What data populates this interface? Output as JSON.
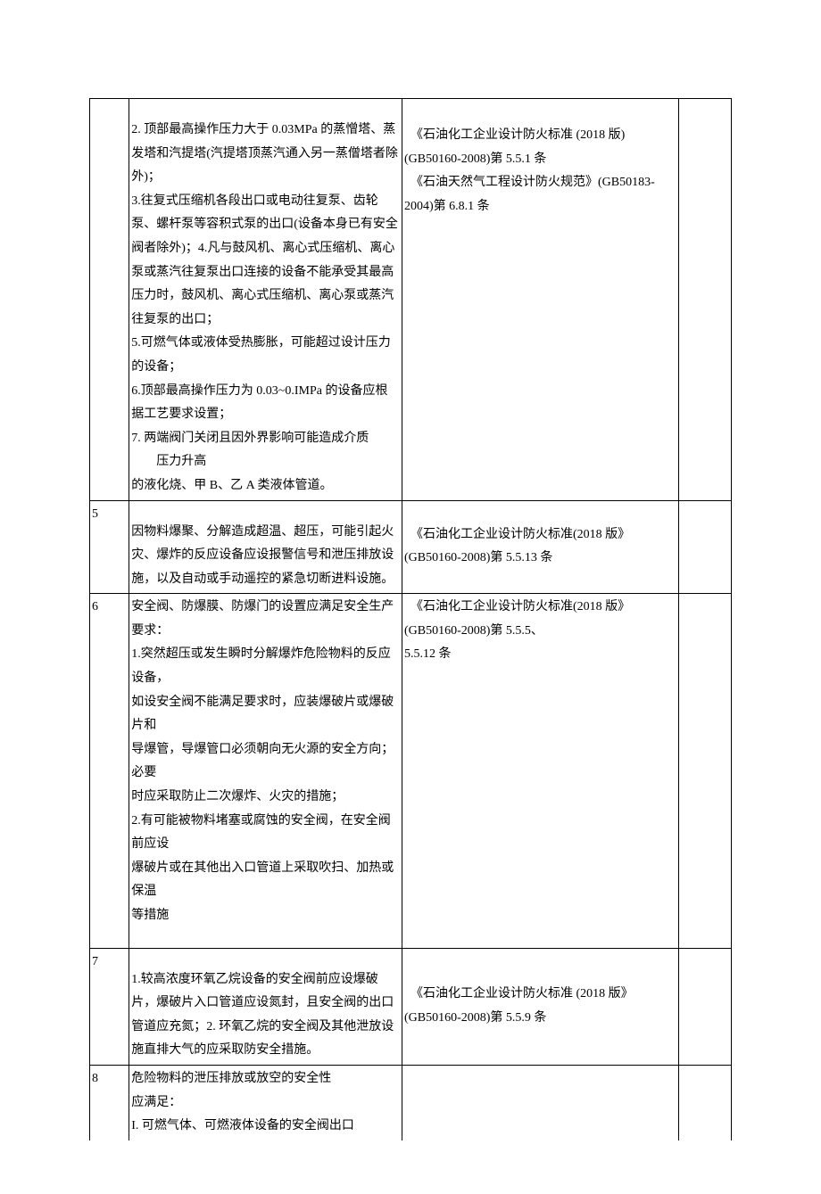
{
  "rows": [
    {
      "num": "",
      "req": "\n2. 顶部最高操作压力大于 0.03MPa 的蒸憎塔、蒸发塔和汽提塔(汽提塔顶蒸汽通入另一蒸僧塔者除外)；\n3.往复式压缩机各段出口或电动往复泵、齿轮泵、螺杆泵等容积式泵的出口(设备本身已有安全阀者除外)；4.凡与鼓风机、离心式压缩机、离心泵或蒸汽往复泵出口连接的设备不能承受其最高压力时，鼓风机、离心式压缩机、离心泵或蒸汽往复泵的出口；\n5.可燃气体或液体受热膨胀，可能超过设计压力的设备；\n6.顶部最高操作压力为 0.03~0.IMPa 的设备应根据工艺要求设置；\n7. 两端阀门关闭且因外界影响可能造成介质压力升高\n的液化烧、甲 B、乙 A 类液体管道。",
      "req_indent": "　压力升高",
      "ref": "　《石油化工企业设计防火标准 (2018 版) (GB50160-2008)第 5.5.1 条\n　《石油天然气工程设计防火规范》(GB50183-2004)第 6.8.1 条"
    },
    {
      "num": "5",
      "req": "\n因物料爆聚、分解造成超温、超压，可能引起火灾、爆炸的反应设备应设报警信号和泄压排放设施，以及自动或手动遥控的紧急切断进料设施。",
      "ref": "　《石油化工企业设计防火标准(2018 版》(GB50160-2008)第 5.5.13 条"
    },
    {
      "num": "6",
      "req": "安全阀、防爆膜、防爆门的设置应满足安全生产要求：\n1.突然超压或发生瞬时分解爆炸危险物料的反应设备，\n如设安全阀不能满足要求时，应装爆破片或爆破片和\n导爆管，导爆管口必须朝向无火源的安全方向；必要\n时应采取防止二次爆炸、火灾的措施；\n2.有可能被物料堵塞或腐蚀的安全阀，在安全阀前应设\n爆破片或在其他出入口管道上采取吹扫、加热或保温\n等措施\n",
      "ref": "　《石油化工企业设计防火标准(2018 版》(GB50160-2008)第 5.5.5、\n5.5.12 条"
    },
    {
      "num": "7",
      "req": "\n1.较高浓度环氧乙烷设备的安全阀前应设爆破片，爆破片入口管道应设氮封，且安全阀的出口管道应充氮；2. 环氧乙烷的安全阀及其他泄放设施直排大气的应采取防安全措施。",
      "ref": "　《石油化工企业设计防火标准 (2018 版》(GB50160-2008)第 5.5.9 条"
    },
    {
      "num": "8",
      "req": "危险物料的泄压排放或放空的安全性\n应满足：\nI. 可燃气体、可燃液体设备的安全阀出口",
      "ref": ""
    }
  ]
}
